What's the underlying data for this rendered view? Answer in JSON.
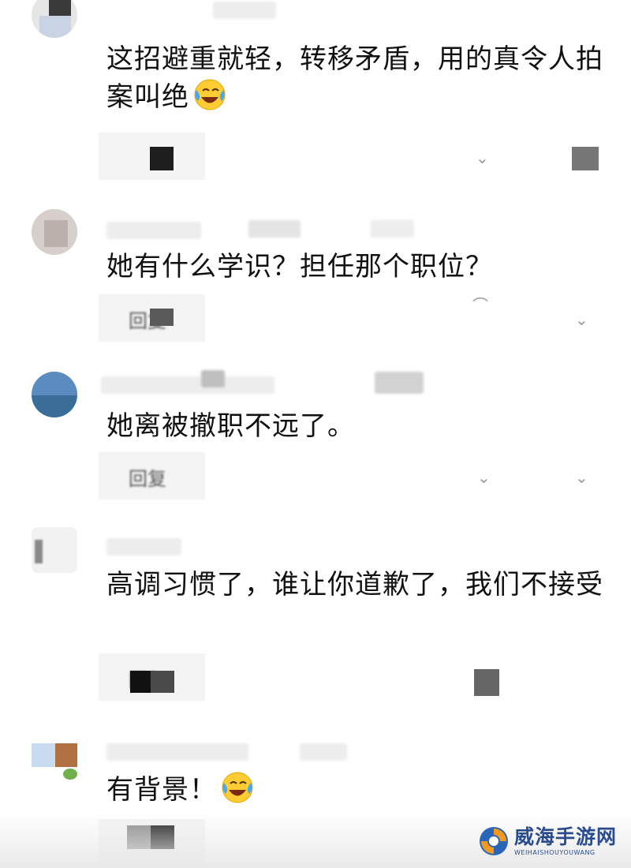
{
  "comments": [
    {
      "text": "这招避重就轻，转移矛盾，用的真令人拍案叫绝",
      "has_emoji": true
    },
    {
      "text": "她有什么学识？担任那个职位？",
      "has_emoji": false
    },
    {
      "text": "她离被撤职不远了。",
      "has_emoji": false
    },
    {
      "text": "高调习惯了，谁让你道歉了，我们不接受",
      "has_emoji": false
    },
    {
      "text": "有背景！",
      "has_emoji": true
    }
  ],
  "reply_label": "回复",
  "watermark": {
    "name": "威海手游网",
    "subtitle": "WEIHAISHOUYOUWANG"
  },
  "icons": {
    "emoji": "laughing-crying-emoji-icon",
    "like": "like-chevron-icon",
    "logo": "swirl-logo-icon"
  }
}
